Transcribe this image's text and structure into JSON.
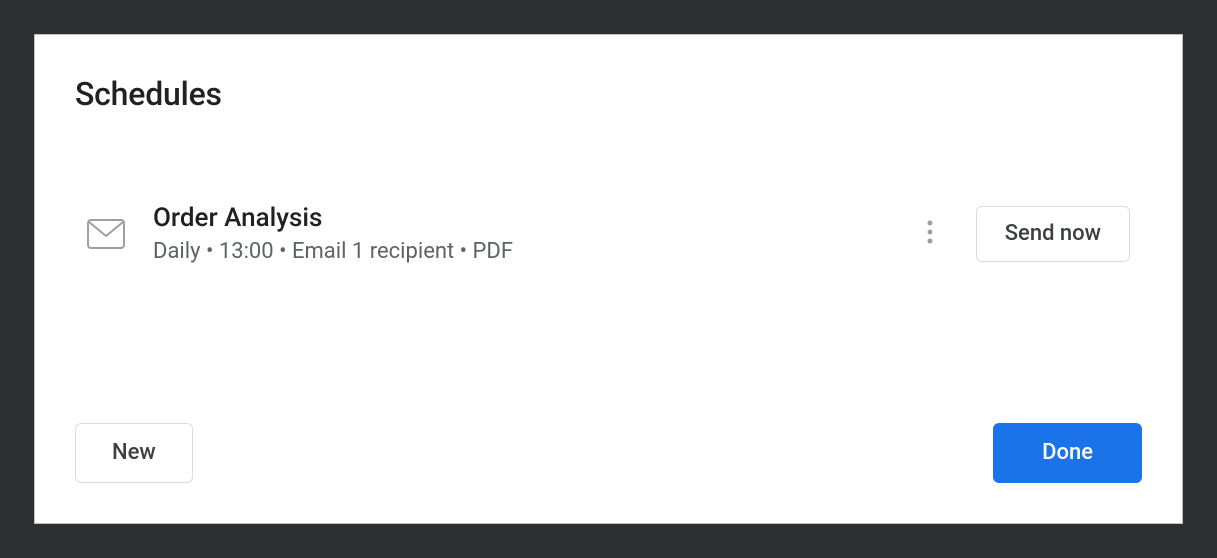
{
  "dialog": {
    "title": "Schedules"
  },
  "schedule": {
    "name": "Order Analysis",
    "details": "Daily • 13:00 • Email 1 recipient • PDF",
    "send_now_label": "Send now"
  },
  "footer": {
    "new_label": "New",
    "done_label": "Done"
  }
}
